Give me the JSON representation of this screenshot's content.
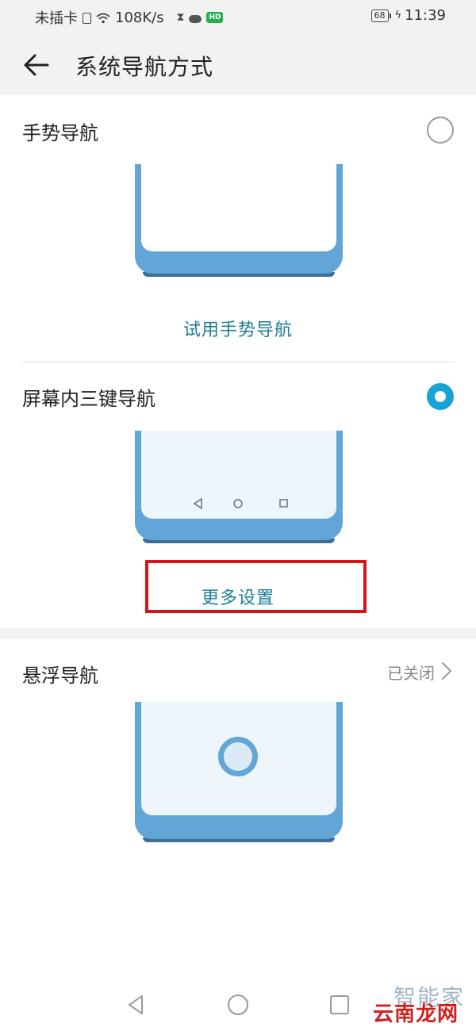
{
  "status_bar": {
    "carrier": "未插卡",
    "speed": "108K/s",
    "app_badge": "HD",
    "battery": "68",
    "time": "11:39"
  },
  "header": {
    "title": "系统导航方式"
  },
  "options": [
    {
      "label": "手势导航",
      "selected": false,
      "action": "试用手势导航"
    },
    {
      "label": "屏幕内三键导航",
      "selected": true,
      "action": "更多设置"
    },
    {
      "label": "悬浮导航",
      "status": "已关闭"
    }
  ],
  "watermark": {
    "top": "智能家",
    "bottom": "云南龙网"
  },
  "colors": {
    "accent": "#16a3d6",
    "link": "#1d7d95",
    "phone_frame": "#62a6d8",
    "phone_screen": "#eef6fb",
    "highlight": "#d8141b"
  }
}
